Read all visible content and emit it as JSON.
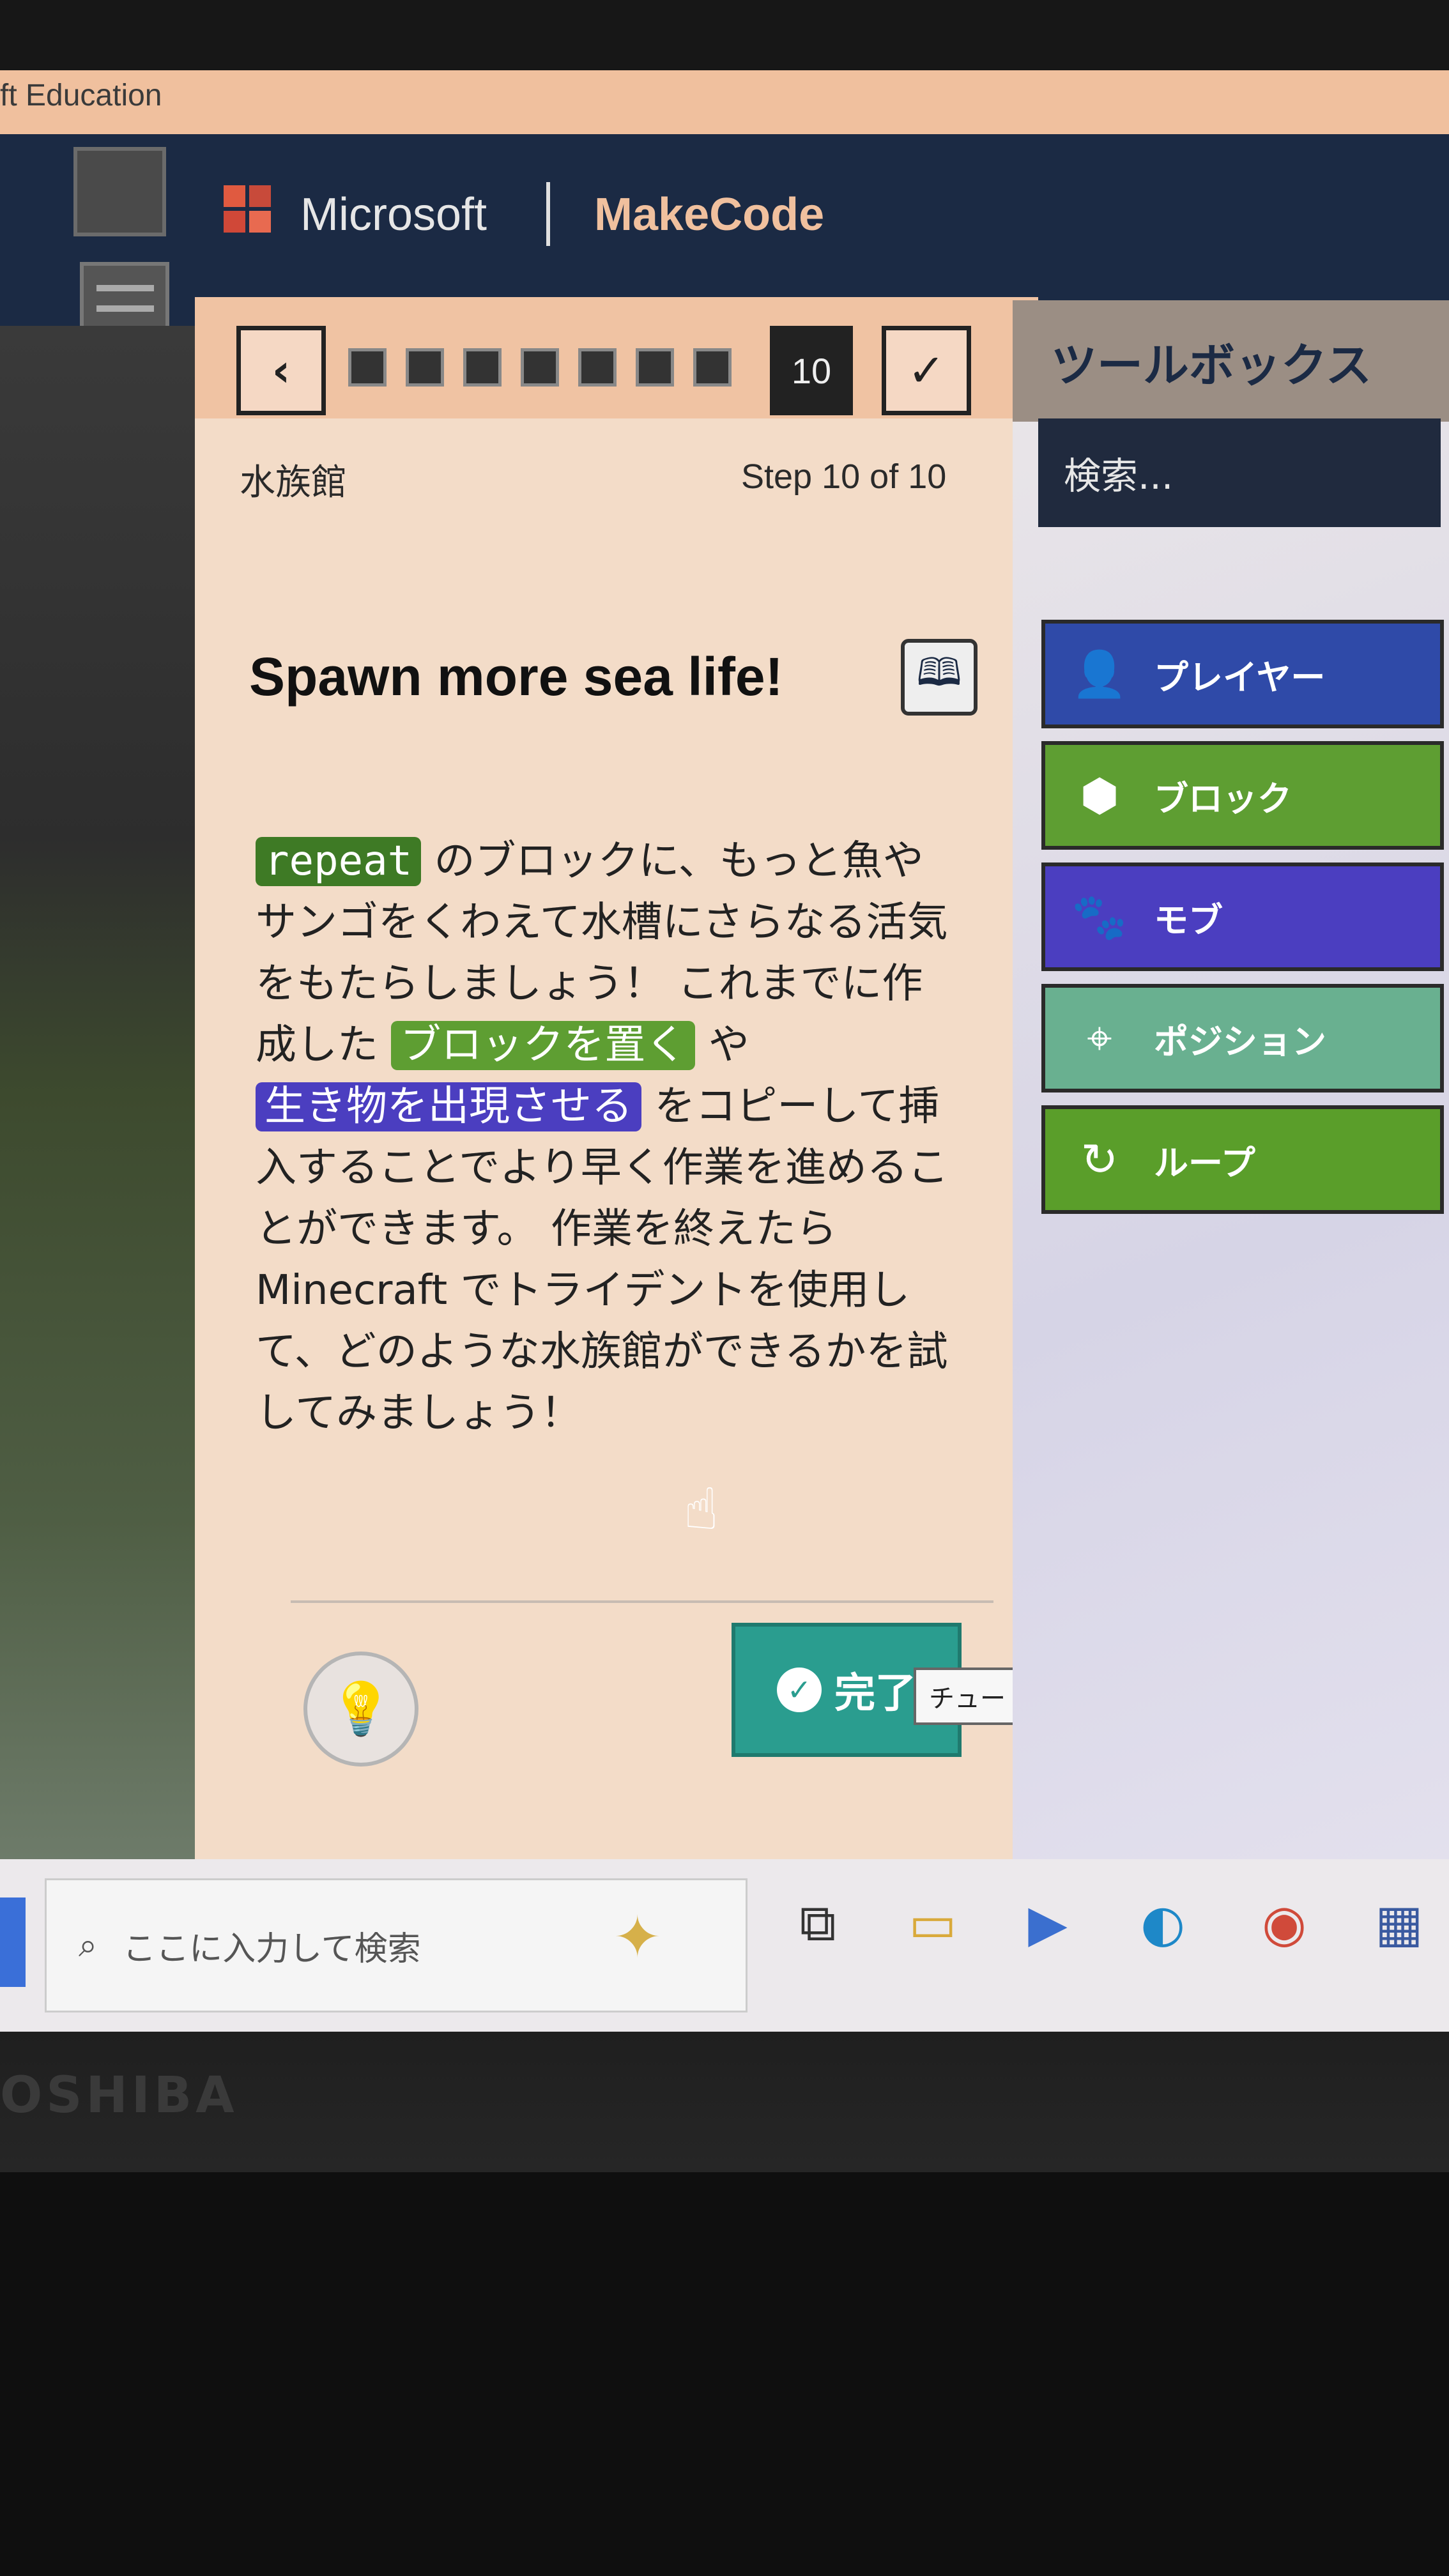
{
  "window": {
    "title": "ft Education"
  },
  "header": {
    "brand_company": "Microsoft",
    "brand_product": "MakeCode"
  },
  "tutorial": {
    "name": "水族館",
    "step_label": "Step 10 of 10",
    "current_step": "10",
    "heading": "Spawn more sea life!",
    "body": {
      "chip_repeat": "repeat",
      "part1": "のブロックに、もっと魚やサンゴをくわえて水槽にさらなる活気をもたらしましょう！ これまでに作成した",
      "chip_place": "ブロックを置く",
      "part2": "や",
      "chip_spawn": "生き物を出現させる",
      "part3": "をコピーして挿入することでより早く作業を進めることができます。 作業を終えたら Minecraft でトライデントを使用して、どのような水族館ができるかを試してみましょう！"
    },
    "done_label": "完了",
    "tooltip": "チュートリアルを終了します。"
  },
  "toolbox": {
    "title": "ツールボックス",
    "search_placeholder": "検索...",
    "categories": [
      {
        "label": "プレイヤー",
        "icon": "person-icon",
        "color": "#2f4aa8"
      },
      {
        "label": "ブロック",
        "icon": "cube-icon",
        "color": "#5e9e32"
      },
      {
        "label": "モブ",
        "icon": "paw-icon",
        "color": "#4b3ec0"
      },
      {
        "label": "ポジション",
        "icon": "crosshair-icon",
        "color": "#69b090"
      },
      {
        "label": "ループ",
        "icon": "loop-icon",
        "color": "#5a9e2a"
      }
    ]
  },
  "taskbar": {
    "search_placeholder": "ここに入力して検索"
  },
  "device": {
    "brand": "OSHIBA"
  }
}
